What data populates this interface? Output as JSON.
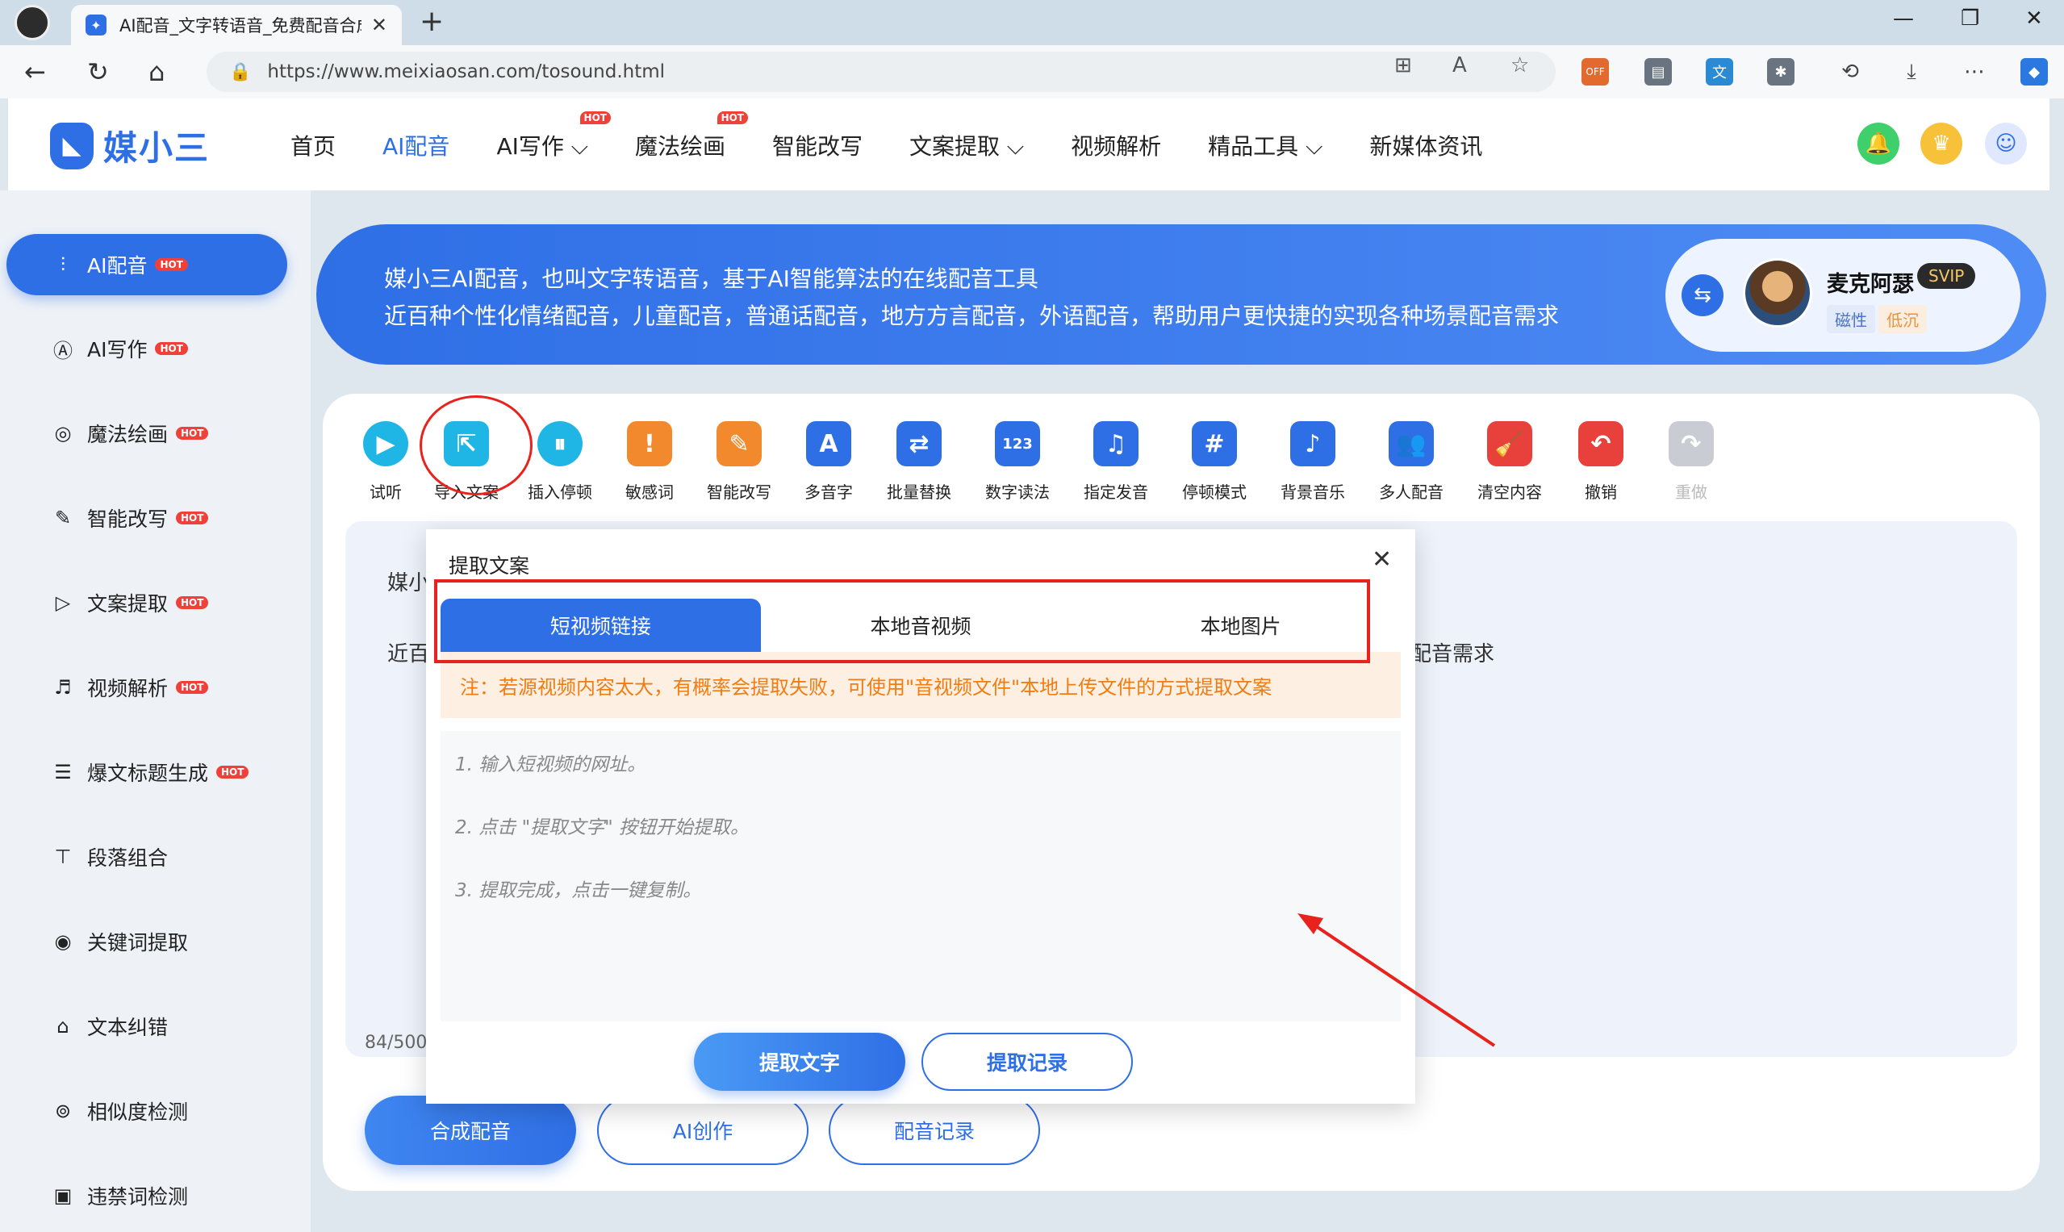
{
  "browser": {
    "tab_title": "AI配音_文字转语音_免费配音合成",
    "url": "https://www.meixiaosan.com/tosound.html",
    "ext_off_label": "OFF"
  },
  "header": {
    "logo_text": "媒小三",
    "nav": [
      {
        "label": "首页",
        "hot": false
      },
      {
        "label": "AI配音",
        "hot": false
      },
      {
        "label": "AI写作",
        "hot": true
      },
      {
        "label": "魔法绘画",
        "hot": true
      },
      {
        "label": "智能改写",
        "hot": false
      },
      {
        "label": "文案提取",
        "hot": false
      },
      {
        "label": "视频解析",
        "hot": false
      },
      {
        "label": "精品工具",
        "hot": false
      },
      {
        "label": "新媒体资讯",
        "hot": false
      }
    ],
    "hot_label": "HOT"
  },
  "sidebar": {
    "items": [
      {
        "label": "AI配音",
        "icon": "waveform-icon",
        "hot": true
      },
      {
        "label": "AI写作",
        "icon": "ai-write-icon",
        "hot": true
      },
      {
        "label": "魔法绘画",
        "icon": "palette-icon",
        "hot": true
      },
      {
        "label": "智能改写",
        "icon": "edit-icon",
        "hot": true
      },
      {
        "label": "文案提取",
        "icon": "video-play-icon",
        "hot": true
      },
      {
        "label": "视频解析",
        "icon": "video-parse-icon",
        "hot": true
      },
      {
        "label": "爆文标题生成",
        "icon": "title-icon",
        "hot": true
      },
      {
        "label": "段落组合",
        "icon": "paragraph-icon",
        "hot": false
      },
      {
        "label": "关键词提取",
        "icon": "target-icon",
        "hot": false
      },
      {
        "label": "文本纠错",
        "icon": "correct-icon",
        "hot": false
      },
      {
        "label": "相似度检测",
        "icon": "similarity-icon",
        "hot": false
      },
      {
        "label": "违禁词检测",
        "icon": "forbidden-icon",
        "hot": false
      }
    ]
  },
  "banner": {
    "line1": "媒小三AI配音，也叫文字转语音，基于AI智能算法的在线配音工具",
    "line2": "近百种个性化情绪配音，儿童配音，普通话配音，地方方言配音，外语配音，帮助用户更快捷的实现各种场景配音需求",
    "voice_name": "麦克阿瑟",
    "voice_level": "SVIP",
    "voice_tags": [
      "磁性",
      "低沉"
    ]
  },
  "toolbar": [
    {
      "label": "试听",
      "glyph": "▶",
      "color": "#1fb6e6"
    },
    {
      "label": "导入文案",
      "glyph": "⇱",
      "color": "#1fb6e6"
    },
    {
      "label": "插入停顿",
      "glyph": "⏸",
      "color": "#1fb6e6"
    },
    {
      "label": "敏感词",
      "glyph": "!",
      "color": "#f28a2d"
    },
    {
      "label": "智能改写",
      "glyph": "✎",
      "color": "#f28a2d"
    },
    {
      "label": "多音字",
      "glyph": "A",
      "color": "#2f6fe6"
    },
    {
      "label": "批量替换",
      "glyph": "⇄",
      "color": "#2f6fe6"
    },
    {
      "label": "数字读法",
      "glyph": "123",
      "color": "#2f6fe6"
    },
    {
      "label": "指定发音",
      "glyph": "♫",
      "color": "#2f6fe6"
    },
    {
      "label": "停顿模式",
      "glyph": "#",
      "color": "#2f6fe6"
    },
    {
      "label": "背景音乐",
      "glyph": "♪",
      "color": "#2f6fe6"
    },
    {
      "label": "多人配音",
      "glyph": "👥",
      "color": "#2f6fe6"
    },
    {
      "label": "清空内容",
      "glyph": "🧹",
      "color": "#e8403a"
    },
    {
      "label": "撤销",
      "glyph": "↶",
      "color": "#e8403a"
    },
    {
      "label": "重做",
      "glyph": "↷",
      "color": "#c9ccd2"
    }
  ],
  "editor": {
    "line1_prefix": "媒小",
    "line2_prefix": "近百",
    "line2_suffix": "配音需求",
    "counter": "84/500"
  },
  "bottom_buttons": {
    "synthesize": "合成配音",
    "ai_create": "AI创作",
    "records": "配音记录"
  },
  "modal": {
    "title": "提取文案",
    "tabs": [
      "短视频链接",
      "本地音视频",
      "本地图片"
    ],
    "notice": "注：若源视频内容太大，有概率会提取失败，可使用\"音视频文件\"本地上传文件的方式提取文案",
    "steps": [
      "1. 输入短视频的网址。",
      "2. 点击 \"提取文字\" 按钮开始提取。",
      "3. 提取完成，点击一键复制。"
    ],
    "extract_button": "提取文字",
    "history_button": "提取记录"
  },
  "colors": {
    "accent": "#2f6fe6",
    "annotation": "#e8221c",
    "notice_text": "#f07c12",
    "notice_bg": "#fdf0e3"
  }
}
